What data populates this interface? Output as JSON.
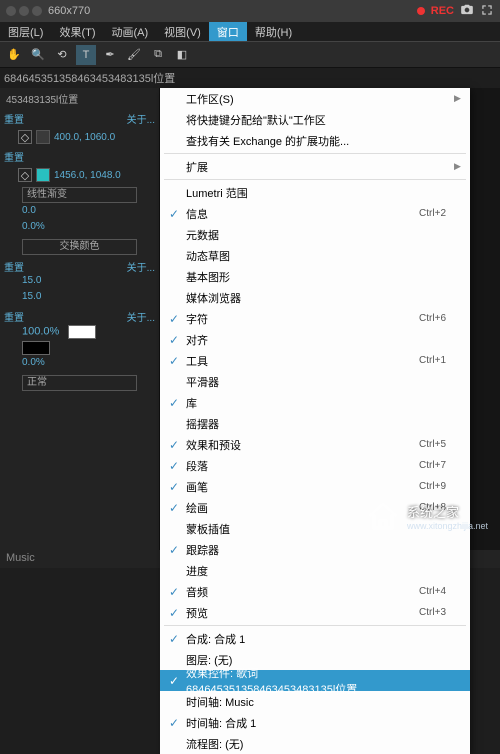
{
  "titlebar": {
    "size": "660x770",
    "rec": "REC"
  },
  "menubar": {
    "layer": "图层(L)",
    "effect": "效果(T)",
    "anim": "动画(A)",
    "view": "视图(V)",
    "window": "窗口",
    "help": "帮助(H)"
  },
  "tabs": {
    "long": "684645351358463453483135l位置",
    "sub": "453483135l位置"
  },
  "panel": {
    "reset_label": "重置",
    "about_label": "关于...",
    "anchor1": "400.0, 1060.0",
    "anchor2": "1456.0, 1048.0",
    "grad_mode": "线性渐变",
    "v0a": "0.0",
    "v0b": "0.0%",
    "swap": "交换颜色",
    "reset2_label": "重置",
    "about2_label": "关于...",
    "v15a": "15.0",
    "v15b": "15.0",
    "reset3_label": "重置",
    "about3_label": "关于...",
    "v100": "100.0%",
    "v0c": "0.0%",
    "mode": "正常"
  },
  "dropdown": {
    "workspace": "工作区(S)",
    "assign": "将快捷键分配给\"默认\"工作区",
    "exchange": "查找有关 Exchange 的扩展功能...",
    "extensions": "扩展",
    "lumetri": "Lumetri 范围",
    "info": "信息",
    "info_sc": "Ctrl+2",
    "metadata": "元数据",
    "motionsketch": "动态草图",
    "shapes": "基本图形",
    "mediabrowser": "媒体浏览器",
    "char": "字符",
    "char_sc": "Ctrl+6",
    "align": "对齐",
    "tools": "工具",
    "tools_sc": "Ctrl+1",
    "smoother": "平滑器",
    "library": "库",
    "wiggler": "摇摆器",
    "effects": "效果和预设",
    "effects_sc": "Ctrl+5",
    "para": "段落",
    "para_sc": "Ctrl+7",
    "brushes": "画笔",
    "brushes_sc": "Ctrl+9",
    "paint": "绘画",
    "paint_sc": "Ctrl+8",
    "maskinterp": "蒙板插值",
    "tracker": "跟踪器",
    "progress": "进度",
    "audio": "音频",
    "audio_sc": "Ctrl+4",
    "preview": "预览",
    "preview_sc": "Ctrl+3",
    "comp": "合成: 合成 1",
    "layer_none": "图层: (无)",
    "ec": "效果控件: 歌词684645351358463453483135l位置",
    "tl_music": "时间轴: Music",
    "tl_comp": "时间轴: 合成 1",
    "flow": "流程图: (无)"
  },
  "bottom": {
    "music": "Music"
  },
  "watermark": {
    "name": "系统之家",
    "url": "www.xitongzhijia.net"
  }
}
